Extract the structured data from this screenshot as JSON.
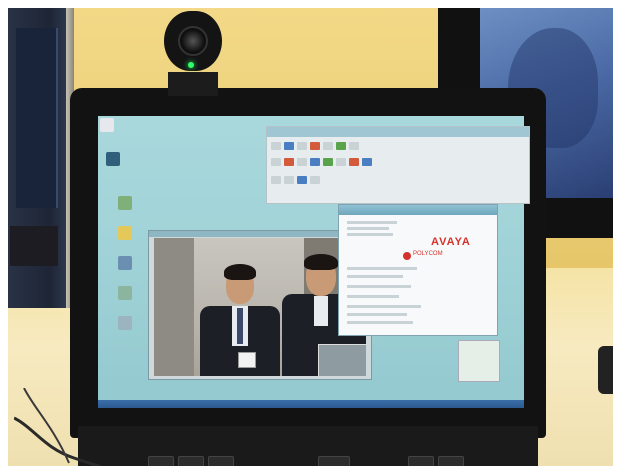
{
  "scene": {
    "description_tags": [
      "laptop",
      "webcam",
      "video-conference"
    ]
  },
  "about_dialog": {
    "brand": "AVAYA",
    "partner": "POLYCOM"
  },
  "colors": {
    "avaya_red": "#d6322c",
    "screen_bg": "#a9d8dc",
    "wall": "#ecd17a"
  }
}
